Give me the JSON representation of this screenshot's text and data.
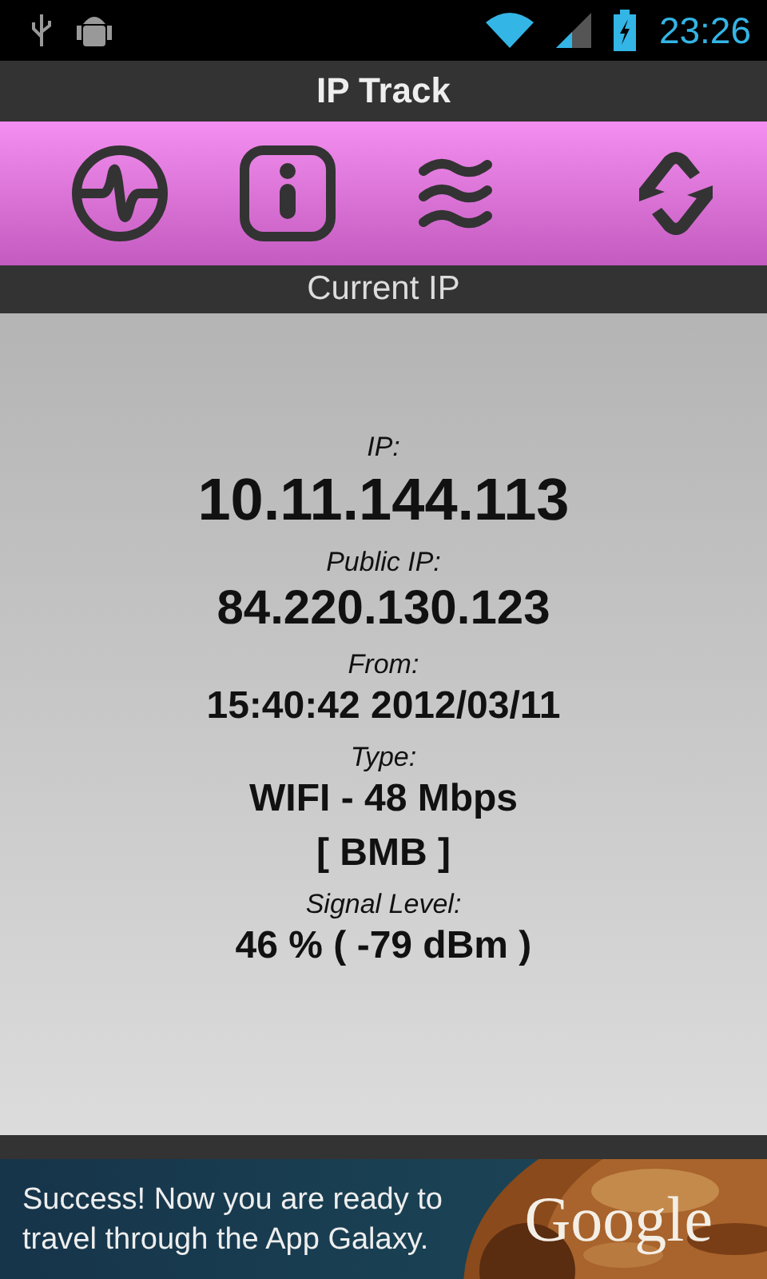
{
  "status_bar": {
    "time": "23:26"
  },
  "title": "IP Track",
  "toolbar": {
    "buttons": [
      {
        "kind": "pulse"
      },
      {
        "kind": "info"
      },
      {
        "kind": "waves"
      },
      {
        "kind": "refresh"
      }
    ]
  },
  "section": {
    "title": "Current IP"
  },
  "details": [
    {
      "kind": "label",
      "text": "IP:"
    },
    {
      "kind": "big",
      "text": "10.11.144.113"
    },
    {
      "kind": "label",
      "text": "Public IP:"
    },
    {
      "kind": "medium",
      "text": "84.220.130.123"
    },
    {
      "kind": "label",
      "text": "From:"
    },
    {
      "kind": "value",
      "text": "15:40:42 2012/03/11"
    },
    {
      "kind": "label",
      "text": "Type:"
    },
    {
      "kind": "value",
      "text": "WIFI - 48 Mbps"
    },
    {
      "kind": "value",
      "text": "[ BMB ]"
    },
    {
      "kind": "label",
      "text": "Signal Level:"
    },
    {
      "kind": "value",
      "text": "46 % ( -79 dBm )"
    }
  ],
  "ad": {
    "text": "Success! Now you are ready to travel through the App Galaxy.",
    "brand": "Google"
  }
}
